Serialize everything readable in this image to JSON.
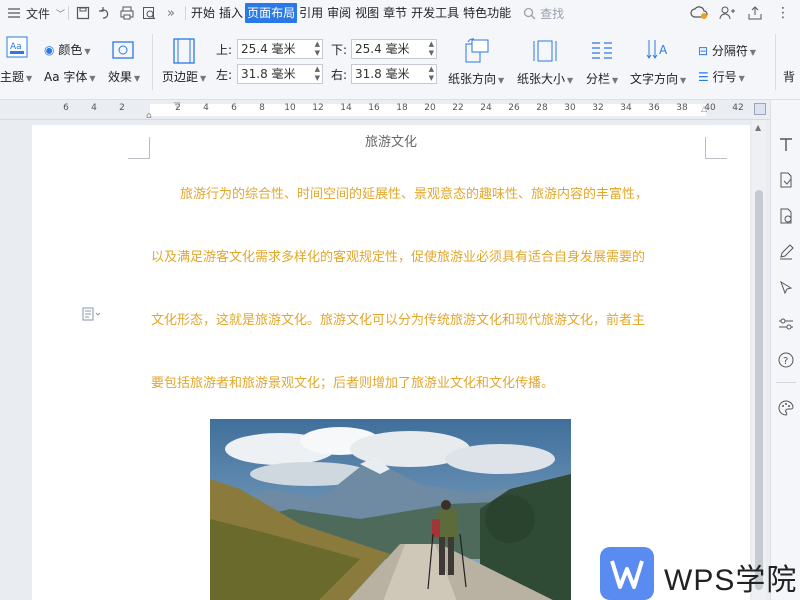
{
  "menubar": {
    "file_label": "文件",
    "tabs": [
      "开始",
      "插入",
      "页面布局",
      "引用",
      "审阅",
      "视图",
      "章节",
      "开发工具",
      "特色功能"
    ],
    "active_tab_index": 2,
    "search_placeholder": "查找"
  },
  "ribbon": {
    "theme_label": "主题",
    "color_label": "颜色",
    "font_label": "字体",
    "effect_label": "效果",
    "margins_label": "页边距",
    "top_label": "上:",
    "top_value": "25.4 毫米",
    "bottom_label": "下:",
    "bottom_value": "25.4 毫米",
    "left_label": "左:",
    "left_value": "31.8 毫米",
    "right_label": "右:",
    "right_value": "31.8 毫米",
    "orientation_label": "纸张方向",
    "size_label": "纸张大小",
    "columns_label": "分栏",
    "text_direction_label": "文字方向",
    "separator_label": "分隔符",
    "line_number_label": "行号",
    "background_label": "背"
  },
  "ruler": {
    "labels": [
      "6",
      "4",
      "2",
      "2",
      "4",
      "6",
      "8",
      "10",
      "12",
      "14",
      "16",
      "18",
      "20",
      "22",
      "24",
      "26",
      "28",
      "30",
      "32",
      "34",
      "36",
      "38",
      "40",
      "42"
    ]
  },
  "document": {
    "header": "旅游文化",
    "paragraph_lines": [
      "旅游行为的综合性、时间空间的延展性、景观意态的趣味性、旅游内容的丰富性，",
      "以及满足游客文化需求多样化的客观规定性，促使旅游业必须具有适合自身发展需要的",
      "文化形态，这就是旅游文化。旅游文化可以分为传统旅游文化和现代旅游文化，前者主",
      "要包括旅游者和旅游景观文化；后者则增加了旅游业文化和文化传播。"
    ],
    "text_color": "#e2a72b"
  },
  "watermark": {
    "text": "WPS学院"
  },
  "colors": {
    "accent": "#2b79e7",
    "logo": "#5a8bf0"
  }
}
